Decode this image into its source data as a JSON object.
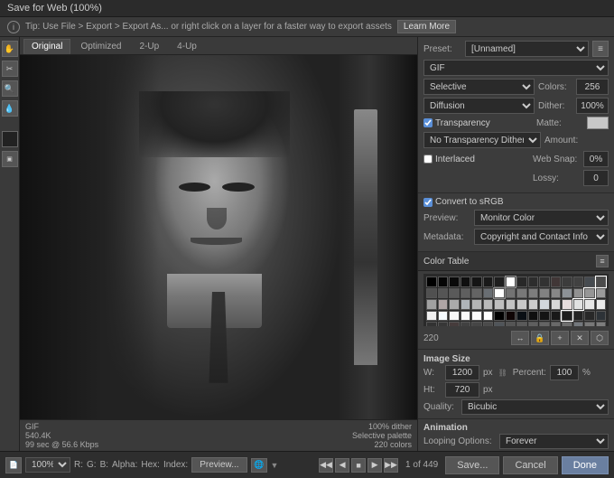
{
  "titleBar": {
    "text": "Save for Web (100%)"
  },
  "tipBar": {
    "icon": "info-icon",
    "text": "Tip: Use File > Export > Export As... or right click on a layer for a faster way to export assets",
    "learnMore": "Learn More"
  },
  "tabs": [
    "Original",
    "Optimized",
    "2-Up",
    "4-Up"
  ],
  "activeTab": "Original",
  "imageInfo": {
    "format": "GIF",
    "size": "540.4K",
    "time": "99 sec @ 56.6 Kbps",
    "dither": "100% dither",
    "palette": "Selective palette",
    "colors": "220 colors"
  },
  "bottomBar": {
    "zoomLevel": "100%",
    "channelR": "R:",
    "channelG": "G:",
    "channelB": "B:",
    "alpha": "Alpha:",
    "hex": "Hex:",
    "index": "Index:",
    "previewBtn": "Preview...",
    "frameCounter": "1 of 449"
  },
  "actionButtons": {
    "save": "Save...",
    "cancel": "Cancel",
    "done": "Done"
  },
  "rightPanel": {
    "preset": {
      "label": "Preset:",
      "value": "[Unnamed]",
      "menuIcon": "≡"
    },
    "format": {
      "value": "GIF"
    },
    "colorReduction": {
      "label": "",
      "value": "Selective"
    },
    "dither": {
      "label": "",
      "value": "Diffusion"
    },
    "colors": {
      "label": "Colors:",
      "value": "256"
    },
    "ditherPct": {
      "label": "Dither:",
      "value": "100%"
    },
    "transparency": {
      "label": "Transparency",
      "checked": true
    },
    "matte": {
      "label": "Matte:"
    },
    "noDither": {
      "label": "No Transparency Dither",
      "value": "No Transparency Dither"
    },
    "amount": {
      "label": "Amount:"
    },
    "interlaced": {
      "label": "Interlaced",
      "checked": false
    },
    "webSnap": {
      "label": "Web Snap:",
      "value": "0%"
    },
    "lossy": {
      "label": "Lossy:",
      "value": "0"
    },
    "convertSRGB": {
      "label": "Convert to sRGB",
      "checked": true
    },
    "preview": {
      "label": "Preview:",
      "value": "Monitor Color"
    },
    "metadata": {
      "label": "Metadata:",
      "value": "Copyright and Contact Info"
    },
    "colorTable": {
      "label": "Color Table",
      "menuIcon": "≡",
      "count": "220"
    },
    "imageSize": {
      "title": "Image Size",
      "wLabel": "W:",
      "wValue": "1200",
      "hLabel": "Ht:",
      "hValue": "720",
      "unit": "px",
      "pctLabel": "Percent:",
      "pctValue": "100",
      "pctUnit": "%",
      "qualityLabel": "Quality:",
      "qualityValue": "Bicubic"
    },
    "animation": {
      "title": "Animation",
      "loopLabel": "Looping Options:",
      "loopValue": "Forever"
    }
  },
  "colorSwatches": [
    "#000000",
    "#111111",
    "#222222",
    "#333333",
    "#444444",
    "#555555",
    "#666666",
    "#777777",
    "#888888",
    "#999999",
    "#aaaaaa",
    "#bbbbbb",
    "#cccccc",
    "#dddddd",
    "#eeeeee",
    "#ffffff",
    "#0a0a0a",
    "#1a1a1a",
    "#2a2a2a",
    "#3a3a3a",
    "#4a4a4a",
    "#5a5a5a",
    "#6a6a6a",
    "#7a7a7a",
    "#8a8a8a",
    "#9a9a9a",
    "#ababab",
    "#bcbcbc",
    "#cdcdcd",
    "#dedede",
    "#efefef",
    "#f5f5f5",
    "#050505",
    "#151515",
    "#252525",
    "#353535",
    "#454545",
    "#656565",
    "#757575",
    "#858585",
    "#959595",
    "#a5a5a5",
    "#b5b5b5",
    "#c5c5c5",
    "#d5d5d5",
    "#e5e5e5",
    "#f0f0f0",
    "#fafafa",
    "#0f0f0f",
    "#1f1f1f",
    "#2f2f2f",
    "#3f3f3f",
    "#4f4f4f",
    "#5f5f5f",
    "#6f6f6f",
    "#7f7f7f",
    "#8f8f8f",
    "#9f9f9f",
    "#afafaf",
    "#bfbfbf",
    "#cfcfcf",
    "#dfdfdf",
    "#ebebeb",
    "#f8f8f8",
    "#030303",
    "#131313",
    "#232323",
    "#434343",
    "#535353",
    "#636363",
    "#737373",
    "#838383",
    "#939393",
    "#a3a3a3",
    "#b3b3b3",
    "#c3c3c3",
    "#d3d3d3",
    "#e3e3e3",
    "#ededed",
    "#f7f7f7",
    "#080808",
    "#181818",
    "#282828",
    "#383838",
    "#484848",
    "#585858",
    "#686868",
    "#787878",
    "#989898",
    "#a8a8a8",
    "#b8b8b8",
    "#c8c8c8",
    "#d8d8d8",
    "#e8e8e8",
    "#f2f2f2",
    "#fcfcfc"
  ]
}
